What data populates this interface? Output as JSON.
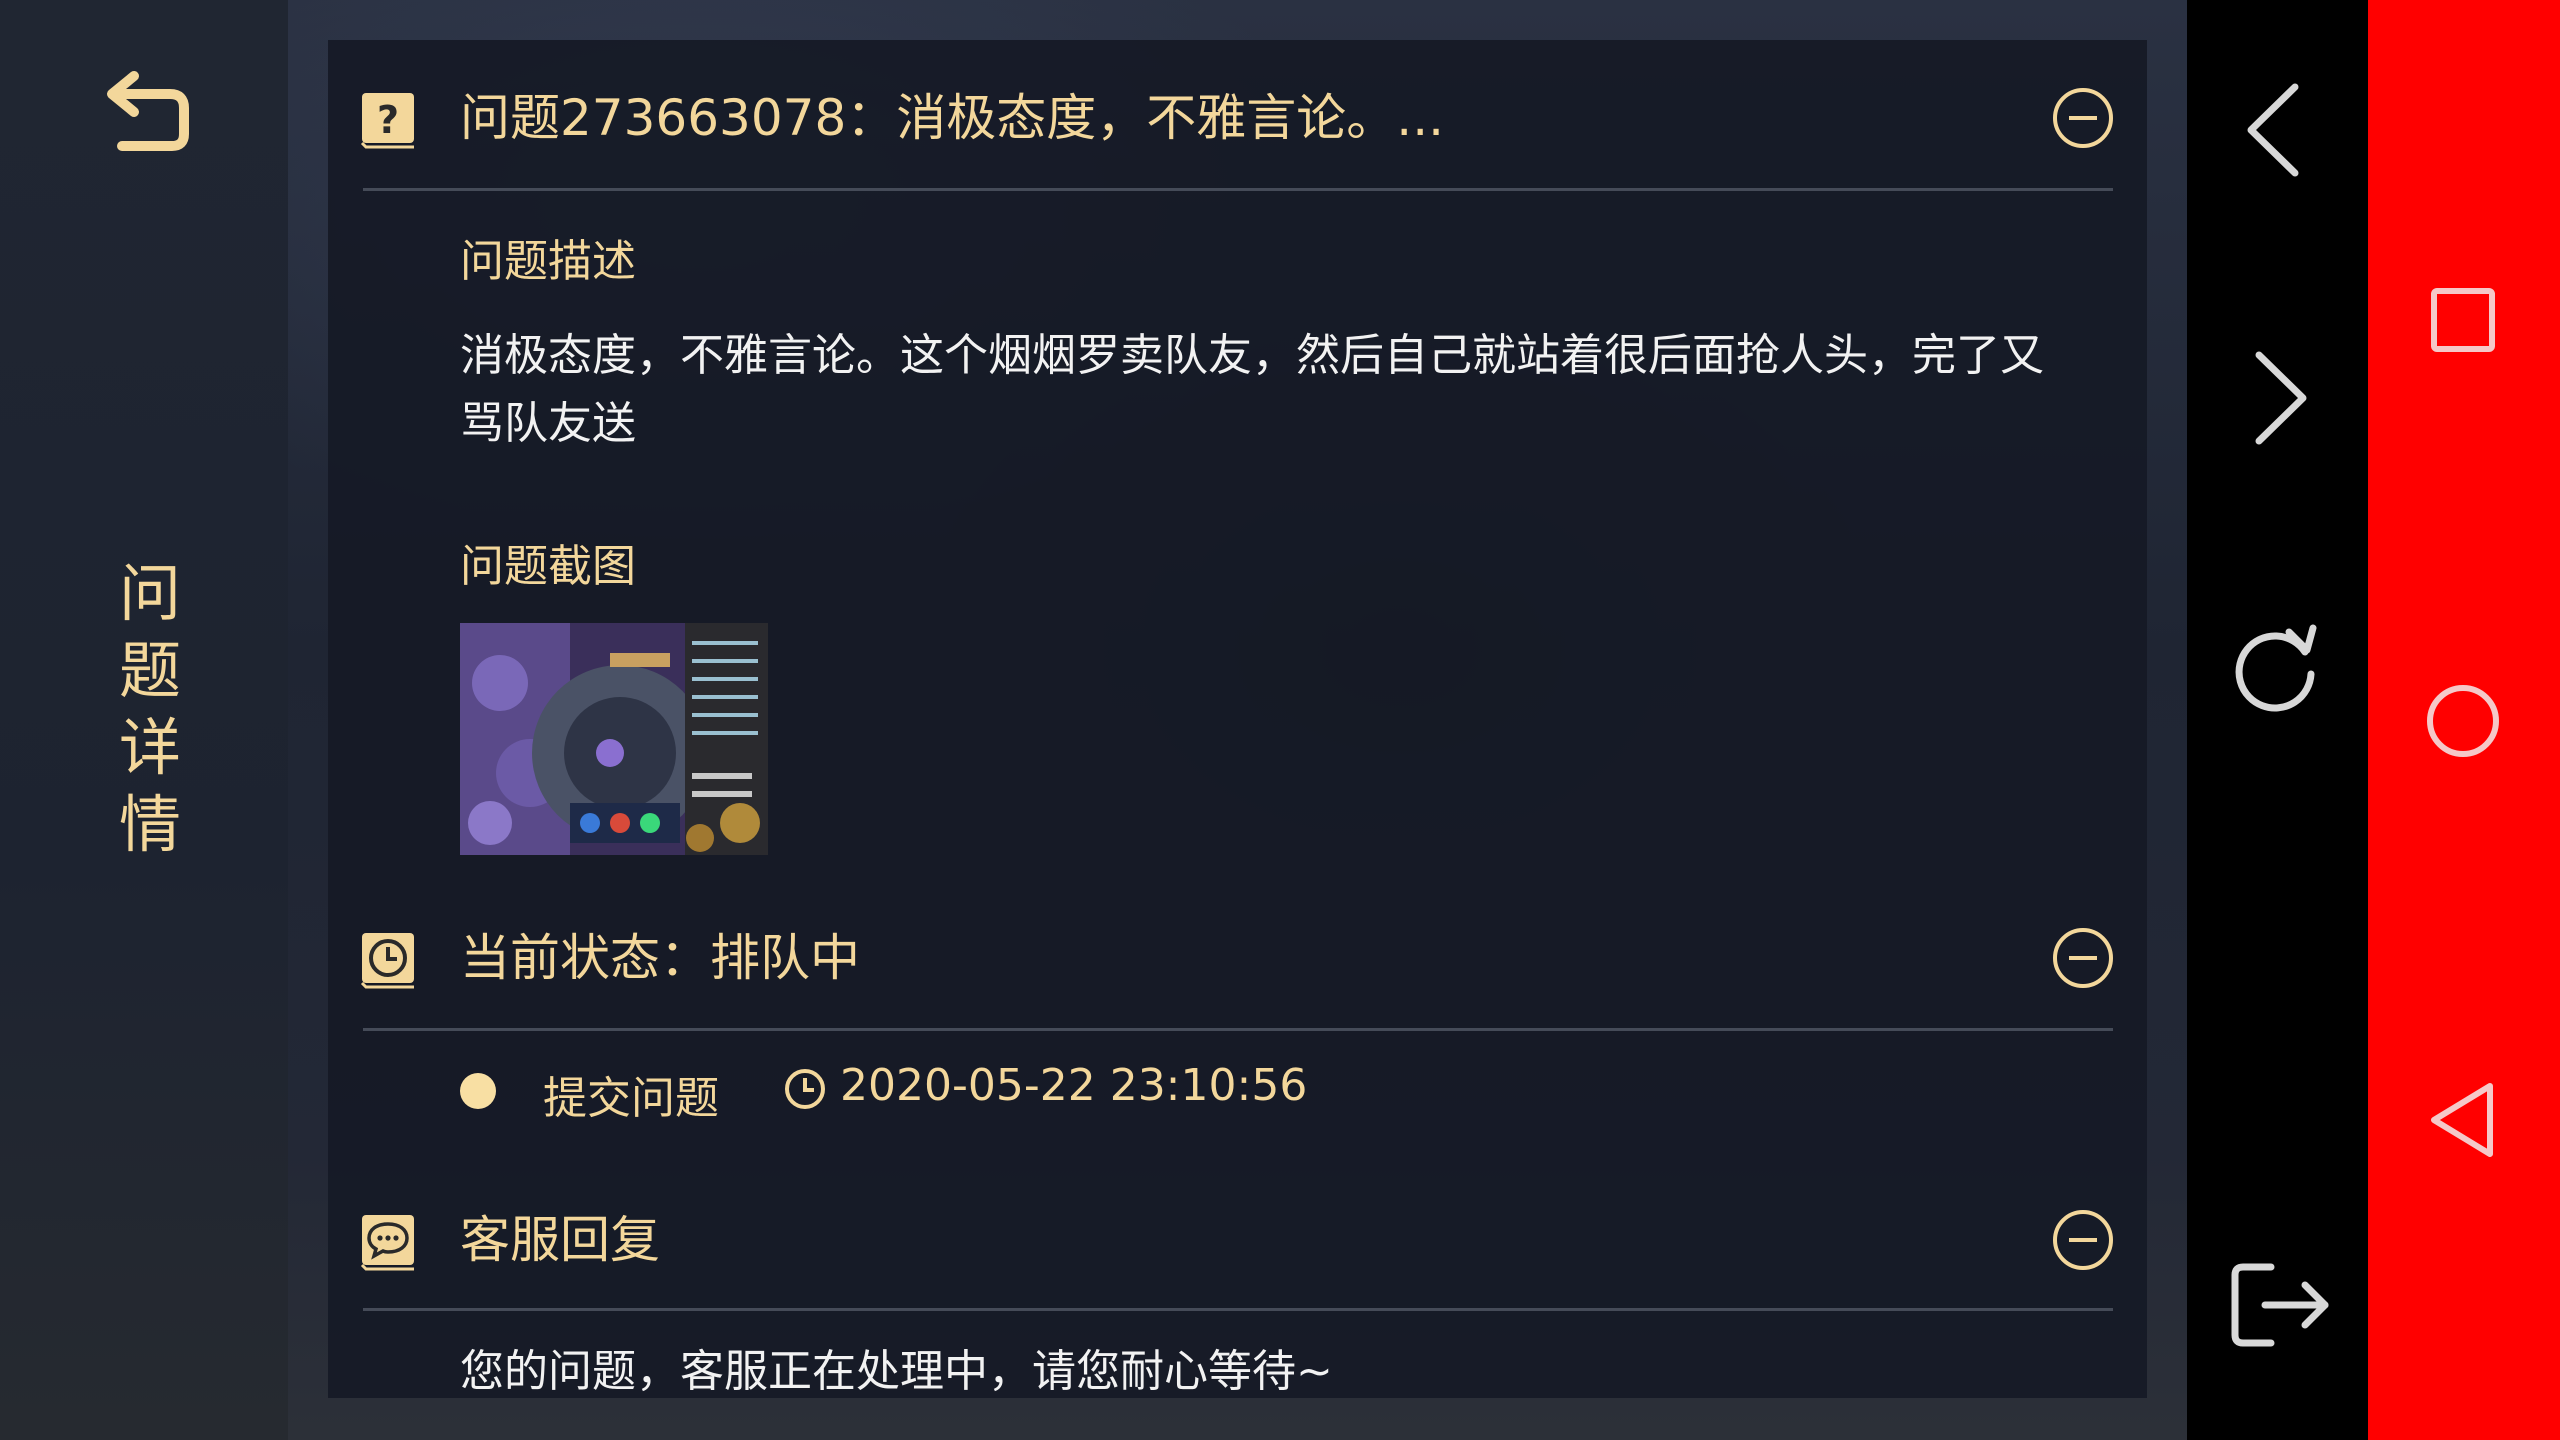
{
  "sidebar": {
    "title_chars": [
      "问",
      "题",
      "详",
      "情"
    ]
  },
  "issue": {
    "title": "问题273663078：消极态度，不雅言论。...",
    "description_label": "问题描述",
    "description": "消极态度，不雅言论。这个烟烟罗卖队友，然后自己就站着很后面抢人头，完了又骂队友送",
    "screenshot_label": "问题截图"
  },
  "status": {
    "title": "当前状态：排队中",
    "step_label": "提交问题",
    "timestamp": "2020-05-22 23:10:56"
  },
  "reply": {
    "title": "客服回复",
    "text": "您的问题，客服正在处理中，请您耐心等待~"
  },
  "icons": {
    "back": "back-arrow-icon",
    "question": "question-icon",
    "clock": "clock-icon",
    "chat": "chat-bubble-icon",
    "collapse": "minus-circle-icon"
  },
  "colors": {
    "accent_gold": "#f3d79b",
    "body_text": "#f2f2f2",
    "panel": "#161a26",
    "nav_red": "#ff0000"
  }
}
